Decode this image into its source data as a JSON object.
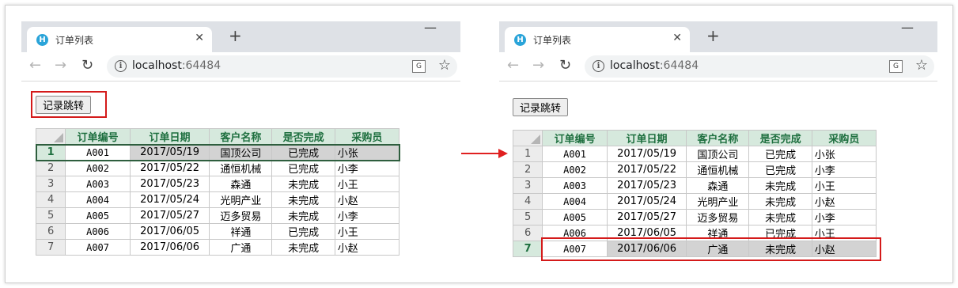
{
  "tab_title": "订单列表",
  "tab_close": "✕",
  "new_tab": "+",
  "minimize": "—",
  "nav": {
    "back": "←",
    "forward": "→",
    "reload": "↻",
    "info": "i",
    "star": "☆",
    "translate": "G"
  },
  "url_host": "localhost",
  "url_port": ":64484",
  "button_label": "记录跳转",
  "columns": [
    "订单编号",
    "订单日期",
    "客户名称",
    "是否完成",
    "采购员"
  ],
  "rows": [
    {
      "num": "1",
      "code": "A001",
      "date": "2017/05/19",
      "customer": "国顶公司",
      "status": "已完成",
      "buyer": "小张"
    },
    {
      "num": "2",
      "code": "A002",
      "date": "2017/05/22",
      "customer": "通恒机械",
      "status": "已完成",
      "buyer": "小李"
    },
    {
      "num": "3",
      "code": "A003",
      "date": "2017/05/23",
      "customer": "森通",
      "status": "未完成",
      "buyer": "小王"
    },
    {
      "num": "4",
      "code": "A004",
      "date": "2017/05/24",
      "customer": "光明产业",
      "status": "未完成",
      "buyer": "小赵"
    },
    {
      "num": "5",
      "code": "A005",
      "date": "2017/05/27",
      "customer": "迈多贸易",
      "status": "未完成",
      "buyer": "小李"
    },
    {
      "num": "6",
      "code": "A006",
      "date": "2017/06/05",
      "customer": "祥通",
      "status": "已完成",
      "buyer": "小王"
    },
    {
      "num": "7",
      "code": "A007",
      "date": "2017/06/06",
      "customer": "广通",
      "status": "未完成",
      "buyer": "小赵"
    }
  ],
  "colors": {
    "highlight_red": "#d41a1a",
    "header_green": "#1e6f3f",
    "header_bg": "#d6e9dd"
  }
}
